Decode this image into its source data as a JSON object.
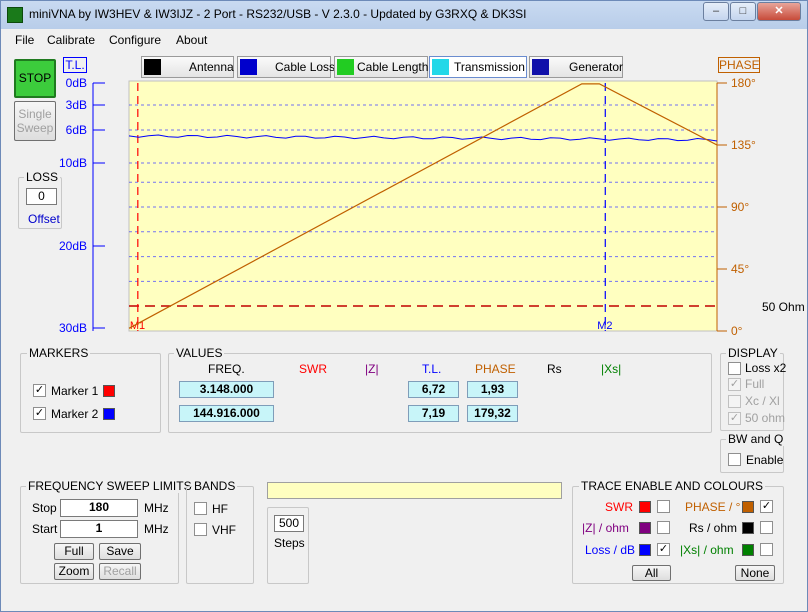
{
  "window": {
    "title": "miniVNA by IW3HEV & IW3IJZ - 2 Port - RS232/USB - V 2.3.0 - Updated by G3RXQ & DK3SI"
  },
  "menu": [
    "File",
    "Calibrate",
    "Configure",
    "About"
  ],
  "controls": {
    "stop": "STOP",
    "single_line1": "Single",
    "single_line2": "Sweep"
  },
  "loss": {
    "title": "LOSS",
    "value": "0",
    "label": "Offset"
  },
  "tabs": [
    "Antenna",
    "Cable Loss",
    "Cable Length",
    "Transmission",
    "Generator"
  ],
  "axis_left": {
    "title": "T.L.",
    "ticks": [
      "0dB",
      "3dB",
      "6dB",
      "10dB",
      "20dB",
      "30dB"
    ]
  },
  "axis_right": {
    "title": "PHASE",
    "ticks": [
      "180°",
      "135°",
      "90°",
      "45°",
      "0°"
    ]
  },
  "chart_data": {
    "type": "line",
    "series": [
      {
        "name": "T.L.",
        "color": "#0000ff",
        "x": [
          0,
          1
        ],
        "values": [
          6.72,
          7.19
        ]
      },
      {
        "name": "PHASE",
        "color": "#c06000",
        "x": [
          0,
          0.77,
          0.8,
          1
        ],
        "values": [
          1.93,
          179.32,
          179.32,
          135
        ]
      }
    ],
    "markers": [
      {
        "label": "M1",
        "color": "#ff0000"
      },
      {
        "label": "M2",
        "color": "#0000ff"
      }
    ],
    "reference_label": "50 Ohm",
    "background": "#ffffc0"
  },
  "markers_panel": {
    "title": "MARKERS",
    "items": [
      {
        "label": "Marker 1",
        "checked": true,
        "color": "#ff0000"
      },
      {
        "label": "Marker 2",
        "checked": true,
        "color": "#0000ff"
      }
    ]
  },
  "values_panel": {
    "title": "VALUES",
    "headers": {
      "freq": "FREQ.",
      "swr": "SWR",
      "z": "|Z|",
      "tl": "T.L.",
      "phase": "PHASE",
      "rs": "Rs",
      "xs": "|Xs|"
    },
    "rows": [
      {
        "freq": "3.148.000",
        "tl": "6,72",
        "phase": "1,93"
      },
      {
        "freq": "144.916.000",
        "tl": "7,19",
        "phase": "179,32"
      }
    ]
  },
  "display": {
    "title": "DISPLAY",
    "items": [
      {
        "label": "Loss x2",
        "checked": false,
        "enabled": true
      },
      {
        "label": "Full",
        "checked": true,
        "enabled": false
      },
      {
        "label": "Xc / Xl",
        "checked": false,
        "enabled": false
      },
      {
        "label": "50 ohm",
        "checked": true,
        "enabled": false
      }
    ]
  },
  "bwq": {
    "title": "BW and Q",
    "label": "Enable"
  },
  "sweep": {
    "title": "FREQUENCY SWEEP LIMITS",
    "stop_label": "Stop",
    "stop_value": "180",
    "start_label": "Start",
    "start_value": "1",
    "unit": "MHz",
    "full": "Full",
    "save": "Save",
    "zoom": "Zoom",
    "recall": "Recall"
  },
  "bands": {
    "title": "BANDS",
    "hf": "HF",
    "vhf": "VHF"
  },
  "steps": {
    "value": "500",
    "label": "Steps"
  },
  "trace": {
    "title": "TRACE ENABLE AND COLOURS",
    "items": [
      {
        "label": "SWR",
        "color": "#ff0000",
        "label_color": "#ff0000",
        "checked": false
      },
      {
        "label": "|Z| / ohm",
        "color": "#800080",
        "label_color": "#800080",
        "checked": false
      },
      {
        "label": "Loss / dB",
        "color": "#0000ff",
        "label_color": "#0000ff",
        "checked": true
      },
      {
        "label": "PHASE / °",
        "color": "#c06000",
        "label_color": "#c06000",
        "checked": true
      },
      {
        "label": "Rs / ohm",
        "color": "#000000",
        "label_color": "#000000",
        "checked": false
      },
      {
        "label": "|Xs| / ohm",
        "color": "#008000",
        "label_color": "#008000",
        "checked": false
      }
    ],
    "all": "All",
    "none": "None"
  }
}
